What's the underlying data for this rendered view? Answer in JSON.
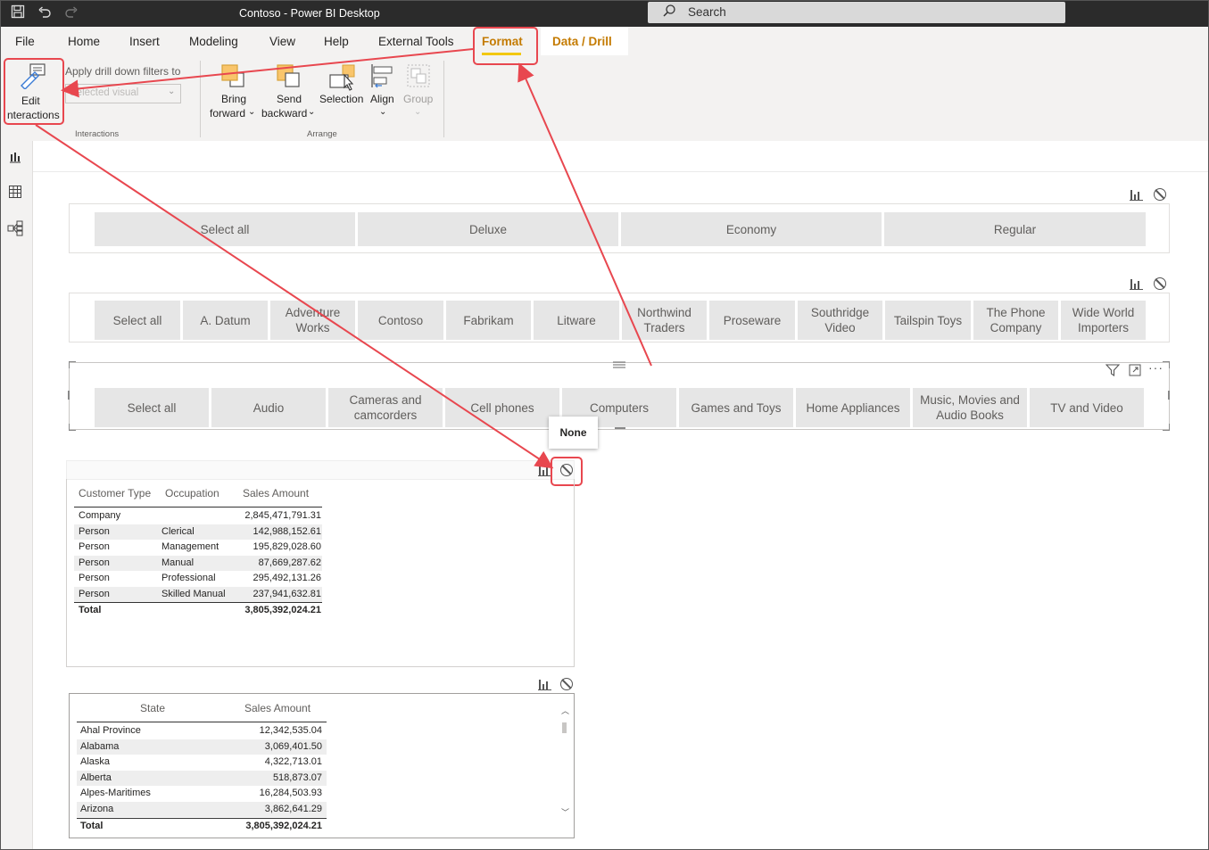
{
  "window": {
    "title": "Contoso - Power BI Desktop"
  },
  "search": {
    "placeholder": "Search"
  },
  "menu": {
    "tabs": [
      "File",
      "Home",
      "Insert",
      "Modeling",
      "View",
      "Help",
      "External Tools",
      "Format",
      "Data / Drill"
    ]
  },
  "ribbon": {
    "edit_interactions_line1": "Edit",
    "edit_interactions_line2": "nteractions",
    "apply_drill_label": "Apply drill down filters to",
    "apply_drill_value": "Selected visual",
    "bring_forward_line1": "Bring",
    "bring_forward_line2": "forward",
    "send_backward_line1": "Send",
    "send_backward_line2": "backward",
    "selection": "Selection",
    "align": "Align",
    "group": "Group",
    "group_interactions": "Interactions",
    "group_arrange": "Arrange"
  },
  "slicers": {
    "customer_type": [
      "Select all",
      "Deluxe",
      "Economy",
      "Regular"
    ],
    "manufacturer": [
      "Select all",
      "A. Datum",
      "Adventure\nWorks",
      "Contoso",
      "Fabrikam",
      "Litware",
      "Northwind\nTraders",
      "Proseware",
      "Southridge\nVideo",
      "Tailspin Toys",
      "The Phone\nCompany",
      "Wide World\nImporters"
    ],
    "category": [
      "Select all",
      "Audio",
      "Cameras and\ncamcorders",
      "Cell phones",
      "Computers",
      "Games and Toys",
      "Home Appliances",
      "Music, Movies and\nAudio Books",
      "TV and Video"
    ]
  },
  "tooltip": {
    "label": "None"
  },
  "table1": {
    "headers": [
      "Customer Type",
      "Occupation",
      "Sales Amount"
    ],
    "rows": [
      [
        "Company",
        "",
        "2,845,471,791.31"
      ],
      [
        "Person",
        "Clerical",
        "142,988,152.61"
      ],
      [
        "Person",
        "Management",
        "195,829,028.60"
      ],
      [
        "Person",
        "Manual",
        "87,669,287.62"
      ],
      [
        "Person",
        "Professional",
        "295,492,131.26"
      ],
      [
        "Person",
        "Skilled Manual",
        "237,941,632.81"
      ]
    ],
    "total_label": "Total",
    "total_value": "3,805,392,024.21"
  },
  "table2": {
    "headers": [
      "State",
      "Sales Amount"
    ],
    "rows": [
      [
        "Ahal Province",
        "12,342,535.04"
      ],
      [
        "Alabama",
        "3,069,401.50"
      ],
      [
        "Alaska",
        "4,322,713.01"
      ],
      [
        "Alberta",
        "518,873.07"
      ],
      [
        "Alpes-Maritimes",
        "16,284,503.93"
      ],
      [
        "Arizona",
        "3,862,641.29"
      ]
    ],
    "total_label": "Total",
    "total_value": "3,805,392,024.21"
  },
  "colors": {
    "accent": "#c47b02",
    "highlight": "#e8474f",
    "underline": "#f2c811"
  }
}
